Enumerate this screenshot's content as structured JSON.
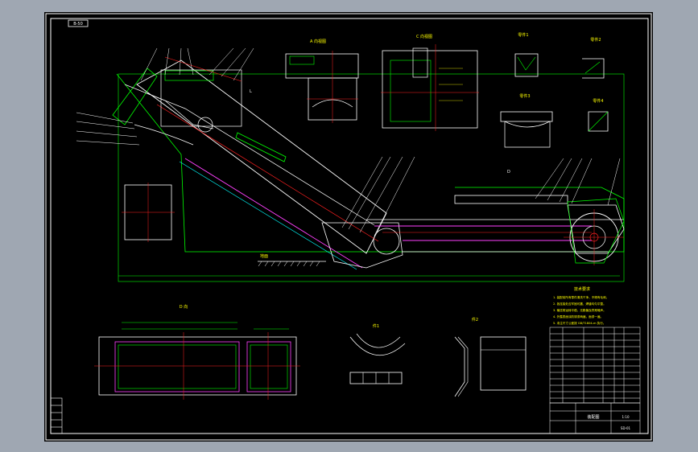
{
  "drawing": {
    "sheet_code": "B-50",
    "views": {
      "view_a": "A 向视图",
      "view_c": "C 向视图",
      "view_d": "D 向",
      "part_1": "零件1",
      "part_2": "零件2",
      "part_3": "零件3",
      "part_4": "零件4",
      "detail_1": "件1",
      "detail_2": "件2"
    },
    "technical_requirements_title": "技术要求",
    "technical_requirements": [
      "1. 装配前所有零件清洗干净，不得有毛刺。",
      "2. 各连接处应牢固可靠，焊缝均匀平整。",
      "3. 输送带运转平稳，无跑偏及异常噪声。",
      "4. 外露表面涂防锈漆两遍，面漆一遍。",
      "5. 未注尺寸公差按 GB/T1804-m 执行。"
    ],
    "title_block": {
      "title": "装配图",
      "drawing_no": "SD-01",
      "scale": "1:10"
    },
    "ground_label": "地面",
    "colors": {
      "outline": "#ffffff",
      "part_line": "#00ff00",
      "center_line": "#ff2020",
      "highlight": "#ff40ff",
      "label": "#ffff00",
      "dimension": "#00ffff"
    }
  }
}
